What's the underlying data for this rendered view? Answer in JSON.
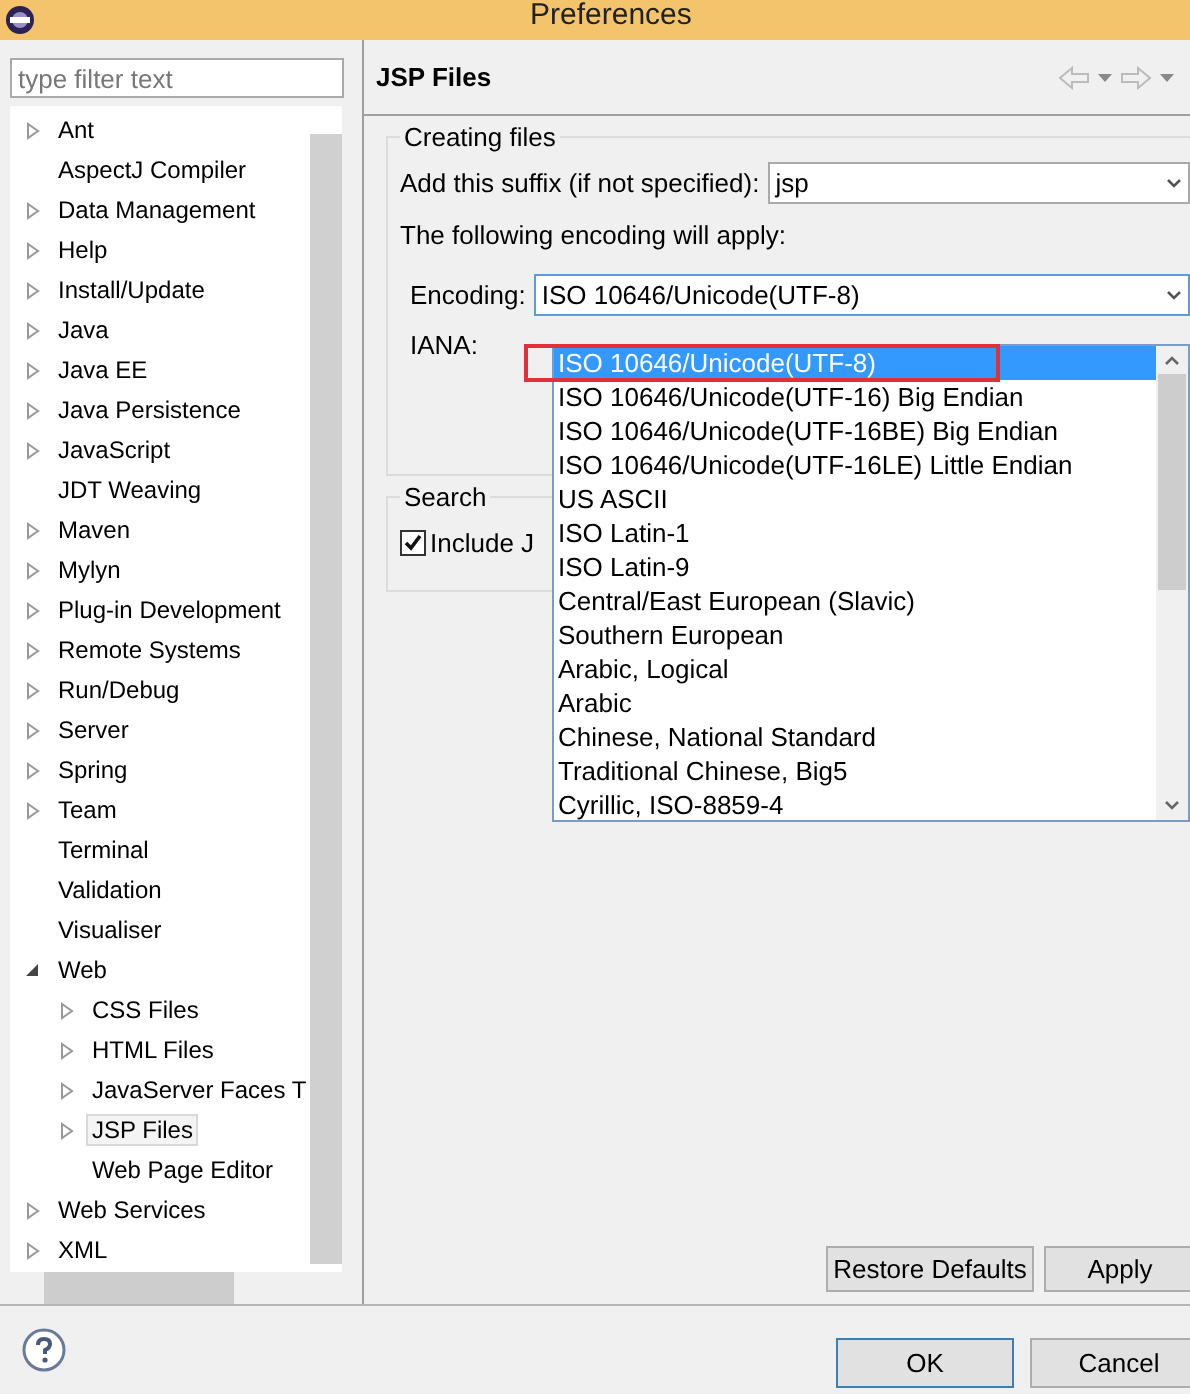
{
  "window": {
    "title": "Preferences"
  },
  "filter": {
    "placeholder": "type filter text"
  },
  "tree": [
    {
      "label": "Ant",
      "kind": "collapsed",
      "selected": false
    },
    {
      "label": "AspectJ Compiler",
      "kind": "leaf",
      "selected": false
    },
    {
      "label": "Data Management",
      "kind": "collapsed",
      "selected": false
    },
    {
      "label": "Help",
      "kind": "collapsed",
      "selected": false
    },
    {
      "label": "Install/Update",
      "kind": "collapsed",
      "selected": false
    },
    {
      "label": "Java",
      "kind": "collapsed",
      "selected": false
    },
    {
      "label": "Java EE",
      "kind": "collapsed",
      "selected": false
    },
    {
      "label": "Java Persistence",
      "kind": "collapsed",
      "selected": false
    },
    {
      "label": "JavaScript",
      "kind": "collapsed",
      "selected": false
    },
    {
      "label": "JDT Weaving",
      "kind": "leaf",
      "selected": false
    },
    {
      "label": "Maven",
      "kind": "collapsed",
      "selected": false
    },
    {
      "label": "Mylyn",
      "kind": "collapsed",
      "selected": false
    },
    {
      "label": "Plug-in Development",
      "kind": "collapsed",
      "selected": false
    },
    {
      "label": "Remote Systems",
      "kind": "collapsed",
      "selected": false
    },
    {
      "label": "Run/Debug",
      "kind": "collapsed",
      "selected": false
    },
    {
      "label": "Server",
      "kind": "collapsed",
      "selected": false
    },
    {
      "label": "Spring",
      "kind": "collapsed",
      "selected": false
    },
    {
      "label": "Team",
      "kind": "collapsed",
      "selected": false
    },
    {
      "label": "Terminal",
      "kind": "leaf",
      "selected": false
    },
    {
      "label": "Validation",
      "kind": "leaf",
      "selected": false
    },
    {
      "label": "Visualiser",
      "kind": "leaf",
      "selected": false
    },
    {
      "label": "Web",
      "kind": "expanded",
      "selected": false,
      "children": [
        {
          "label": "CSS Files",
          "kind": "collapsed",
          "selected": false
        },
        {
          "label": "HTML Files",
          "kind": "collapsed",
          "selected": false
        },
        {
          "label": "JavaServer Faces T",
          "kind": "collapsed",
          "selected": false
        },
        {
          "label": "JSP Files",
          "kind": "collapsed",
          "selected": true
        },
        {
          "label": "Web Page Editor",
          "kind": "leaf",
          "selected": false
        }
      ]
    },
    {
      "label": "Web Services",
      "kind": "collapsed",
      "selected": false
    },
    {
      "label": "XML",
      "kind": "collapsed",
      "selected": false
    }
  ],
  "page": {
    "title": "JSP Files",
    "creating_files": {
      "title": "Creating files",
      "suffix_label": "Add this suffix (if not specified):",
      "suffix_value": "jsp",
      "encoding_note": "The following encoding will apply:",
      "encoding_label": "Encoding:",
      "encoding_value": "ISO 10646/Unicode(UTF-8)",
      "iana_label": "IANA:"
    },
    "search": {
      "title": "Search",
      "include_label": "Include J",
      "checked": true
    },
    "encoding_list": [
      {
        "label": "ISO 10646/Unicode(UTF-8)",
        "selected": true
      },
      {
        "label": "ISO 10646/Unicode(UTF-16) Big Endian",
        "selected": false
      },
      {
        "label": "ISO 10646/Unicode(UTF-16BE) Big Endian",
        "selected": false
      },
      {
        "label": "ISO 10646/Unicode(UTF-16LE) Little Endian",
        "selected": false
      },
      {
        "label": "US ASCII",
        "selected": false
      },
      {
        "label": "ISO Latin-1",
        "selected": false
      },
      {
        "label": "ISO Latin-9",
        "selected": false
      },
      {
        "label": "Central/East European (Slavic)",
        "selected": false
      },
      {
        "label": "Southern European",
        "selected": false
      },
      {
        "label": "Arabic, Logical",
        "selected": false
      },
      {
        "label": "Arabic",
        "selected": false
      },
      {
        "label": "Chinese, National Standard",
        "selected": false
      },
      {
        "label": "Traditional Chinese, Big5",
        "selected": false
      },
      {
        "label": "Cyrillic, ISO-8859-4",
        "selected": false
      }
    ],
    "buttons": {
      "restore": "Restore Defaults",
      "apply": "Apply"
    }
  },
  "dialog_buttons": {
    "ok": "OK",
    "cancel": "Cancel"
  }
}
